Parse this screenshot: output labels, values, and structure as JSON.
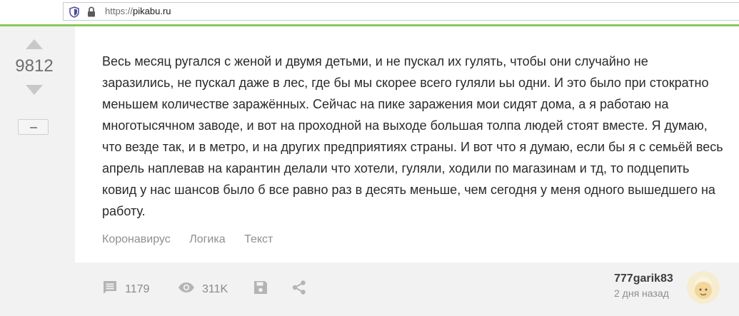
{
  "browser": {
    "url_scheme": "https://",
    "url_host": "pikabu.ru",
    "accent_color": "#8ac858"
  },
  "rating": {
    "value": "9812",
    "minus_label": "−"
  },
  "story": {
    "text": "Весь месяц ругался с женой и двумя детьми, и не пускал их гулять, чтобы они случайно не заразились, не пускал даже в лес, где бы мы скорее всего гуляли ьы одни. И это было при стократно меньшем количестве заражённых. Сейчас на пике заражения мои сидят дома, а я работаю на многотысячном заводе, и вот на проходной на выходе большая толпа людей стоят вместе. Я думаю, что везде так, и в метро, и на других предприятиях страны. И вот что я думаю, если бы я с семьёй весь апрель наплевав на карантин делали что хотели, гуляли, ходили по магазинам и тд, то подцепить ковид у нас шансов было б все равно раз в десять меньше, чем сегодня у меня одного вышедшего на работу.",
    "tags": [
      "Коронавирус",
      "Логика",
      "Текст"
    ]
  },
  "footer": {
    "comments_count": "1179",
    "views_count": "311K",
    "author": "777garik83",
    "posted": "2 дня назад",
    "icons": [
      "comment-icon",
      "eye-icon",
      "save-icon",
      "share-icon"
    ]
  }
}
